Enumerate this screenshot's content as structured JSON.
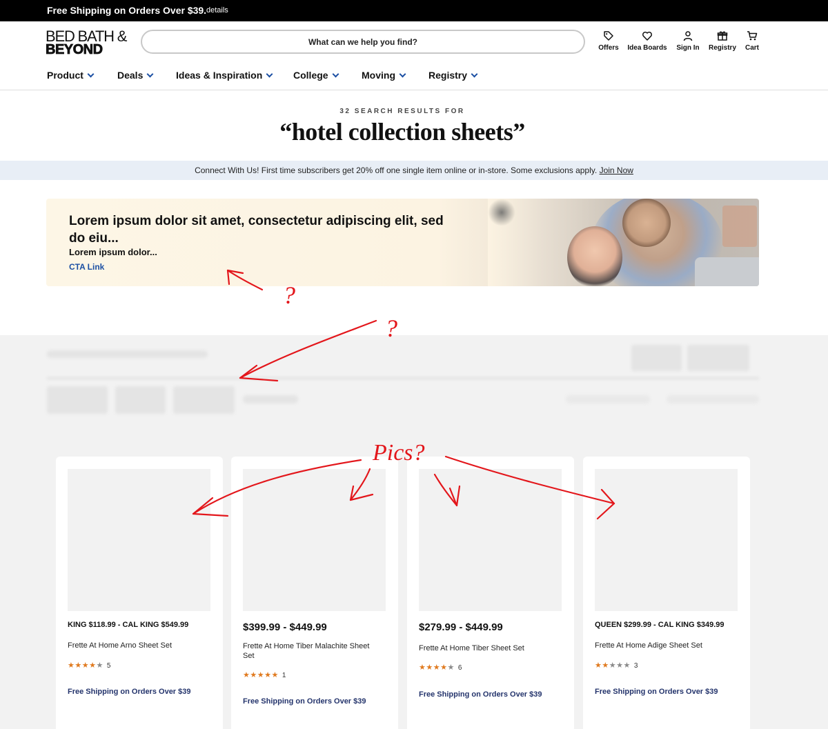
{
  "promo": {
    "text": "Free Shipping on Orders Over $39.",
    "details_link": "details"
  },
  "logo": {
    "line1": "BED BATH &",
    "line2": "BEYOND"
  },
  "search": {
    "placeholder": "What can we help you find?"
  },
  "header_icons": [
    {
      "label": "Offers",
      "icon": "tag-icon"
    },
    {
      "label": "Idea Boards",
      "icon": "heart-icon"
    },
    {
      "label": "Sign In",
      "icon": "user-icon"
    },
    {
      "label": "Registry",
      "icon": "gift-icon"
    },
    {
      "label": "Cart",
      "icon": "cart-icon"
    }
  ],
  "nav": [
    {
      "label": "Product"
    },
    {
      "label": "Deals"
    },
    {
      "label": "Ideas & Inspiration"
    },
    {
      "label": "College"
    },
    {
      "label": "Moving"
    },
    {
      "label": "Registry"
    }
  ],
  "results": {
    "count_label": "32 SEARCH RESULTS FOR",
    "query": "“hotel collection sheets”"
  },
  "subscribe": {
    "text": "Connect With Us! First time subscribers get 20% off one single item online or in-store. Some exclusions apply.",
    "link": "Join Now"
  },
  "banner": {
    "title": "Lorem ipsum dolor sit amet, consectetur adipiscing elit, sed do eiu...",
    "subtitle": "Lorem ipsum dolor...",
    "cta": "CTA Link"
  },
  "annotations": {
    "q1": "?",
    "q2": "?",
    "pics": "Pics?"
  },
  "products": [
    {
      "price": "KING $118.99 - CAL KING $549.99",
      "title": "Frette At Home Arno Sheet Set",
      "rating": 4,
      "review_count": "5",
      "shipping": "Free Shipping on Orders Over $39"
    },
    {
      "price": "$399.99 - $449.99",
      "title": "Frette At Home Tiber Malachite Sheet Set",
      "rating": 5,
      "review_count": "1",
      "shipping": "Free Shipping on Orders Over $39"
    },
    {
      "price": "$279.99 - $449.99",
      "title": "Frette At Home Tiber Sheet Set",
      "rating": 3.5,
      "review_count": "6",
      "shipping": "Free Shipping on Orders Over $39"
    },
    {
      "price": "QUEEN $299.99 - CAL KING $349.99",
      "title": "Frette At Home Adige Sheet Set",
      "rating": 2,
      "review_count": "3",
      "shipping": "Free Shipping on Orders Over $39"
    }
  ],
  "colors": {
    "promo_bg": "#000000",
    "accent_blue": "#1b4fa3",
    "star": "#e07a1f",
    "shipping_text": "#24346c",
    "subscribe_bg": "#e8eef6",
    "annotation": "#e3161b"
  }
}
